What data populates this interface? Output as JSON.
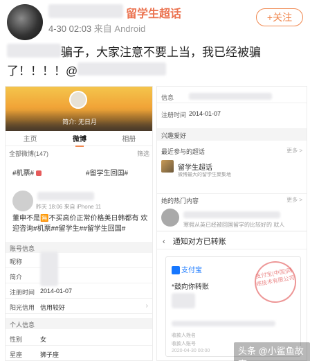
{
  "post": {
    "supertopic": "留学生超话",
    "time": "4-30 02:03",
    "source": "来自 Android",
    "follow_label": "+关注",
    "line1": "骗子，大家注意不要上当，我已经被骗",
    "line2": "了！！！！@"
  },
  "left_shot": {
    "banner_name": "",
    "banner_intro": "简介: 无日月",
    "tabs": [
      "主页",
      "微博",
      "相册"
    ],
    "active_tab": "微博",
    "feed_label": "全部微博(147)",
    "feed_tools": "筛选",
    "tag_a": "#机票#",
    "tag_b": "#留学生回国#",
    "tweet_meta": "昨天 18:06 来自 iPhone 11",
    "tweet_body": "董申不是🈚不买高价正常价格美日韩都有 欢迎咨询#机票##留学生##留学生回国#",
    "account_header": "账号信息",
    "rows": [
      {
        "label": "昵称",
        "value": ""
      },
      {
        "label": "简介",
        "value": ""
      },
      {
        "label": "注册时间",
        "value": "2014-01-07"
      },
      {
        "label": "阳光信用",
        "value": "信用较好"
      }
    ],
    "personal_header": "个人信息",
    "personal_rows": [
      {
        "label": "性别",
        "value": "女"
      },
      {
        "label": "星座",
        "value": "狮子座"
      }
    ]
  },
  "right_shot": {
    "info_label": "信息",
    "reg_label": "注册时间",
    "reg_value": "2014-01-07",
    "interest_header": "兴趣爱好",
    "recent_header": "最近参与的超话",
    "more_label": "更多 >",
    "super_title": "留学生超话",
    "super_sub": "微博最大的留学生聚集地",
    "hot_header": "她的热门内容",
    "hot_text": "寒假从英已经被回国留学的比较好的 就人",
    "transfer_title": "通知对方已转账",
    "alipay": "支付宝",
    "stamp_text": "支付宝(中国)网络技术有限公司",
    "card_msg": "*鼓向你转账",
    "card_label_1": "收款人姓名",
    "card_label_2": "收款人账号",
    "card_time": "2020-04-30 00:00"
  },
  "watermark": "头条 @小鲨鱼故事",
  "colors": {
    "accent_orange": "#eb7350",
    "follow_orange": "#f08850",
    "alipay_blue": "#1677ff"
  }
}
